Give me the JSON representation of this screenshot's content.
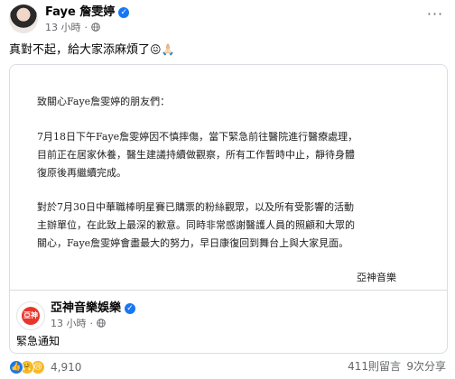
{
  "post": {
    "author": "Faye 詹雯婷",
    "time": "13 小時",
    "separator": "·",
    "more_icon": "more-horizontal-icon",
    "caption": "真對不起，給大家添麻煩了",
    "caption_emoji": "😖🙏🏻"
  },
  "letter": {
    "greeting": "致關心Faye詹雯婷的朋友們：",
    "p1_line1": "7月18日下午Faye詹雯婷因不慎摔傷，當下緊急前往醫院進行醫療處理，",
    "p1_line2": "目前正在居家休養，醫生建議持續做觀察，所有工作暫時中止，靜待身體",
    "p1_line3": "復原後再繼續完成。",
    "p2_line1": "對於7月30日中華職棒明星賽已購票的粉絲觀眾，以及所有受影響的活動",
    "p2_line2": "主辦單位，在此致上最深的歉意。同時非常感謝醫護人員的照顧和大眾的",
    "p2_line3": "關心，Faye詹雯婷會盡最大的努力，早日康復回到舞台上與大家見面。",
    "signature": "亞神音樂"
  },
  "shared_page": {
    "name": "亞神音樂娛樂",
    "avatar_text": "亞神",
    "time": "13 小時",
    "separator": "·",
    "body": "緊急通知"
  },
  "footer": {
    "reaction_count": "4,910",
    "comments": "411則留言",
    "shares": "9次分享"
  }
}
